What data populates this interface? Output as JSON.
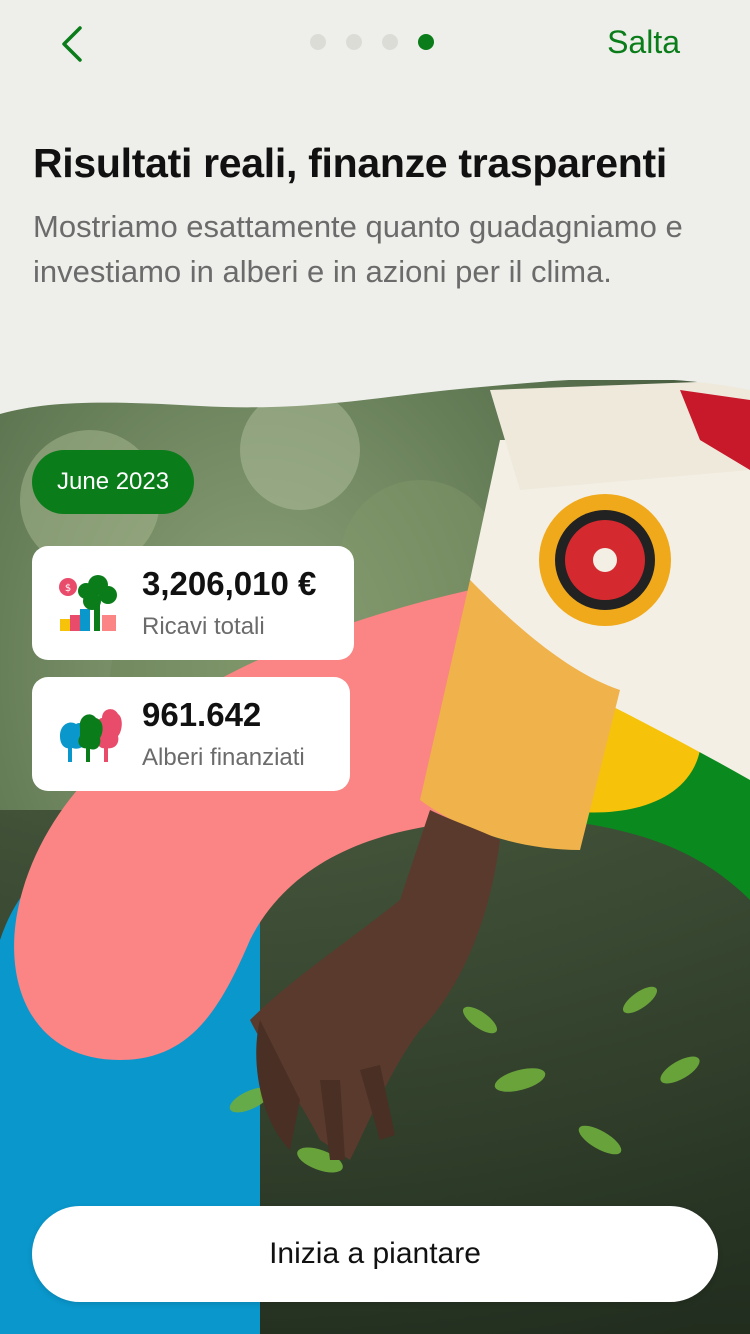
{
  "nav": {
    "back_icon": "chevron-left-icon",
    "skip_label": "Salta",
    "pager": {
      "total": 4,
      "active": 4
    }
  },
  "header": {
    "title": "Risultati reali, finanze trasparenti",
    "subtitle": "Mostriamo esattamente quanto guadagniamo e investiamo in alberi e in azioni per il clima."
  },
  "report": {
    "month": "June 2023",
    "revenue": {
      "value": "3,206,010 €",
      "label": "Ricavi totali",
      "icon": "revenue-tree-icon"
    },
    "trees": {
      "value": "961.642",
      "label": "Alberi finanziati",
      "icon": "trees-icon"
    }
  },
  "cta": {
    "label": "Inizia a piantare"
  },
  "colors": {
    "accent": "#0a7d1a",
    "background": "#eeefea",
    "shape_pink": "#fb8484",
    "shape_blue": "#0a97cc",
    "shape_yellow": "#f6c20a",
    "shape_green": "#0a8a1e"
  }
}
